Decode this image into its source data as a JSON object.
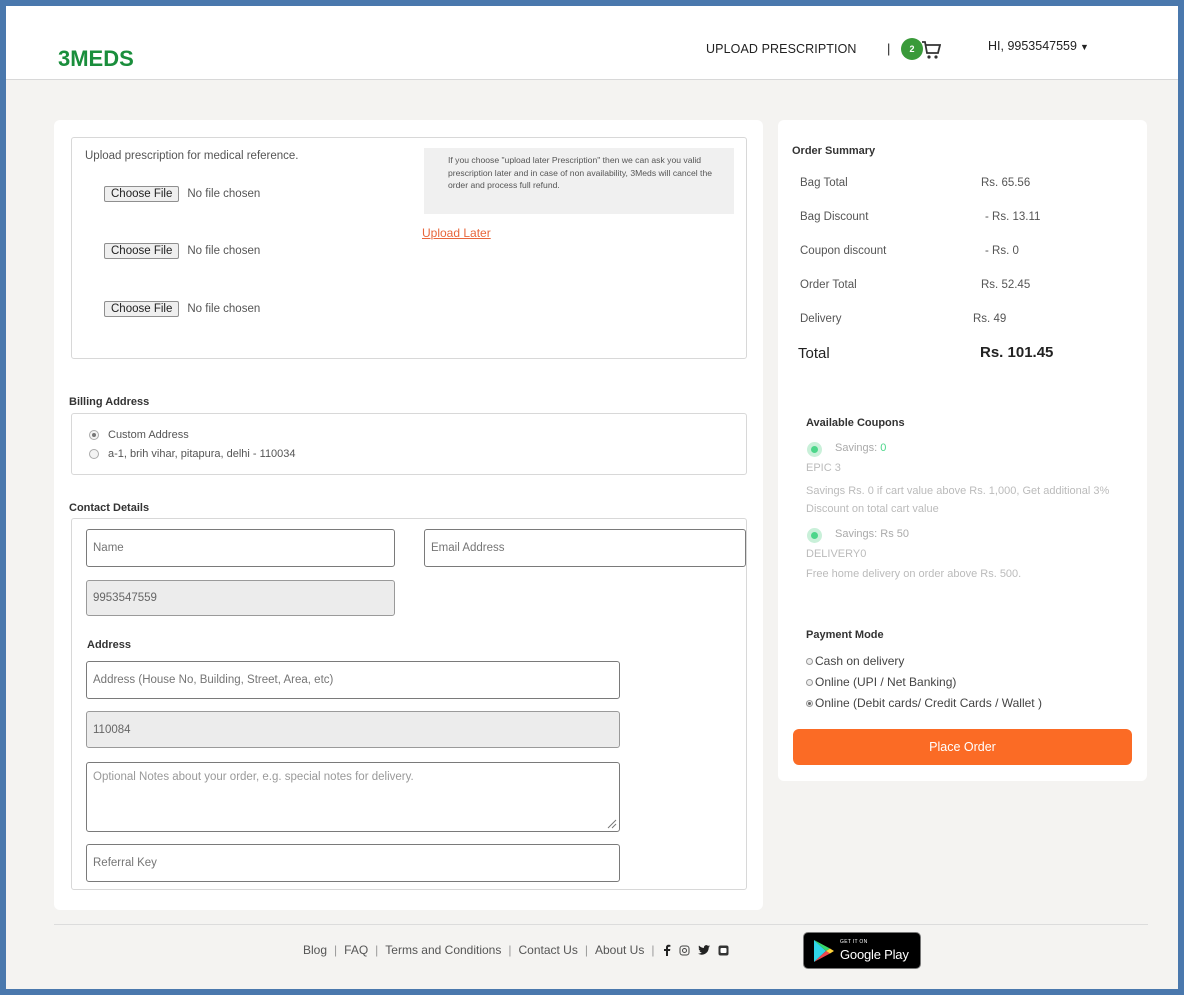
{
  "header": {
    "logo_main": "3MEDS",
    "logo_sub": "",
    "upload_prescription": "UPLOAD PRESCRIPTION",
    "separator": "|",
    "cart_count": "2",
    "greeting": "HI, 9953547559"
  },
  "upload": {
    "title": "Upload prescription for medical reference.",
    "choose_file_label": "Choose File",
    "no_file_text": "No file chosen",
    "note": "If you choose \"upload later Prescription\" then we can ask you valid prescription later and in case of non availability, 3Meds will cancel the order and process full refund.",
    "upload_later": "Upload Later"
  },
  "billing": {
    "title": "Billing Address",
    "options": [
      "Custom Address",
      "a-1, brih vihar, pitapura, delhi - 110034"
    ]
  },
  "contact": {
    "title": "Contact Details",
    "name_placeholder": "Name",
    "email_placeholder": "Email Address",
    "phone_value": "9953547559",
    "address_title": "Address",
    "address_placeholder": "Address (House No, Building, Street, Area, etc)",
    "pincode_value": "110084",
    "notes_placeholder": "Optional Notes about your order, e.g. special notes for delivery.",
    "referral_placeholder": "Referral Key"
  },
  "summary": {
    "title": "Order Summary",
    "bag_total_label": "Bag Total",
    "bag_total_value": "Rs. 65.56",
    "bag_discount_label": "Bag Discount",
    "bag_discount_value": "- Rs. 13.11",
    "coupon_discount_label": "Coupon discount",
    "coupon_discount_value": "- Rs. 0",
    "order_total_label": "Order Total",
    "order_total_value": "Rs. 52.45",
    "delivery_label": "Delivery",
    "delivery_value": "Rs. 49",
    "total_label": "Total",
    "total_value": "Rs. 101.45"
  },
  "coupons": {
    "title": "Available Coupons",
    "savings_label": "Savings:",
    "items": [
      {
        "savings": "0",
        "code": "EPIC 3",
        "description": "Savings Rs. 0 if cart value above Rs. 1,000, Get additional 3% Discount on total cart value"
      },
      {
        "savings": "Rs 50",
        "code": "DELIVERY0",
        "description": "Free home delivery on order above Rs. 500."
      }
    ]
  },
  "payment": {
    "title": "Payment Mode",
    "options": [
      "Cash on delivery",
      "Online (UPI / Net Banking)",
      "Online (Debit cards/ Credit Cards / Wallet )"
    ],
    "place_order": "Place Order"
  },
  "footer": {
    "links": [
      "Blog",
      "FAQ",
      "Terms and Conditions",
      "Contact Us",
      "About Us"
    ],
    "separator": "|",
    "google_play_sub": "GET IT ON",
    "google_play_main": "Google Play"
  },
  "colors": {
    "accent": "#fb6b25",
    "brand_green": "#1a8e3c",
    "coupon_green": "#4cd68a"
  }
}
